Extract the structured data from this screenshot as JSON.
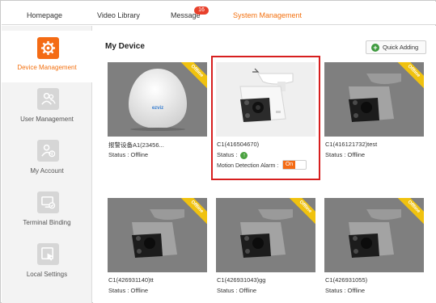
{
  "nav": {
    "items": [
      "Homepage",
      "Video Library",
      "Message",
      "System Management"
    ],
    "message_badge": "16",
    "active": "System Management"
  },
  "sidebar": {
    "items": [
      {
        "label": "Device Management",
        "icon": "gear-icon",
        "active": true
      },
      {
        "label": "User Management",
        "icon": "users-icon",
        "active": false
      },
      {
        "label": "My Account",
        "icon": "account-icon",
        "active": false
      },
      {
        "label": "Terminal Binding",
        "icon": "terminal-binding-icon",
        "active": false
      },
      {
        "label": "Local Settings",
        "icon": "local-settings-icon",
        "active": false
      }
    ]
  },
  "main": {
    "title": "My Device",
    "quick_add_label": "Quick Adding",
    "status_label": "Status :",
    "offline_text": "Offline",
    "corner_label": "Offline",
    "motion_label": "Motion Detection Alarm :",
    "toggle_on": "On",
    "devices": [
      {
        "name": "报警设备A1(23456...",
        "status": "Offline",
        "online": false
      },
      {
        "name": "C1(416504670)",
        "status": "",
        "online": true
      },
      {
        "name": "C1(416121732)test",
        "status": "Offline",
        "online": false
      },
      {
        "name": "C1(426931140)tt",
        "status": "Offline",
        "online": false
      },
      {
        "name": "C1(426931043)gg",
        "status": "Offline",
        "online": false
      },
      {
        "name": "C1(426931055)",
        "status": "Offline",
        "online": false
      }
    ],
    "brand_text": "ezviz"
  },
  "colors": {
    "accent": "#f46b14",
    "badge": "#e8412c",
    "offline_corner": "#f0c20f",
    "highlight": "#d71f1f"
  }
}
